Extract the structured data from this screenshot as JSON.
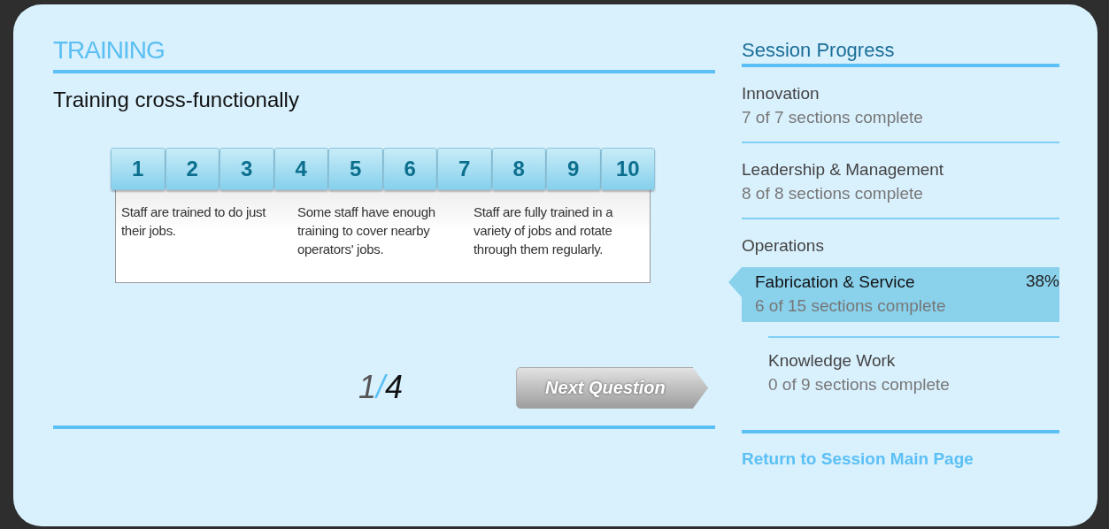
{
  "section_title": "TRAINING",
  "question": "Training cross-functionally",
  "scale": {
    "points": [
      "1",
      "2",
      "3",
      "4",
      "5",
      "6",
      "7",
      "8",
      "9",
      "10"
    ],
    "descriptions": [
      "Staff are trained to do just their jobs.",
      "Some staff have enough training to cover nearby operators' jobs.",
      "Staff are fully trained in a variety of jobs and rotate through them regularly."
    ]
  },
  "counter": {
    "current": "1",
    "separator": "/",
    "total": "4"
  },
  "next_button": "Next Question",
  "progress": {
    "title": "Session Progress",
    "items": [
      {
        "name": "Innovation",
        "status": "7 of 7 sections complete",
        "selected": false
      },
      {
        "name": "Leadership & Management",
        "status": "8 of 8 sections complete",
        "selected": false
      },
      {
        "name": "Operations",
        "selected": false,
        "children": [
          {
            "name": "Fabrication & Service",
            "status": "6 of 15 sections complete",
            "percent": "38%",
            "selected": true
          },
          {
            "name": "Knowledge Work",
            "status": "0 of 9 sections complete",
            "selected": false
          }
        ]
      }
    ],
    "link": "Return to Session Main Page"
  }
}
